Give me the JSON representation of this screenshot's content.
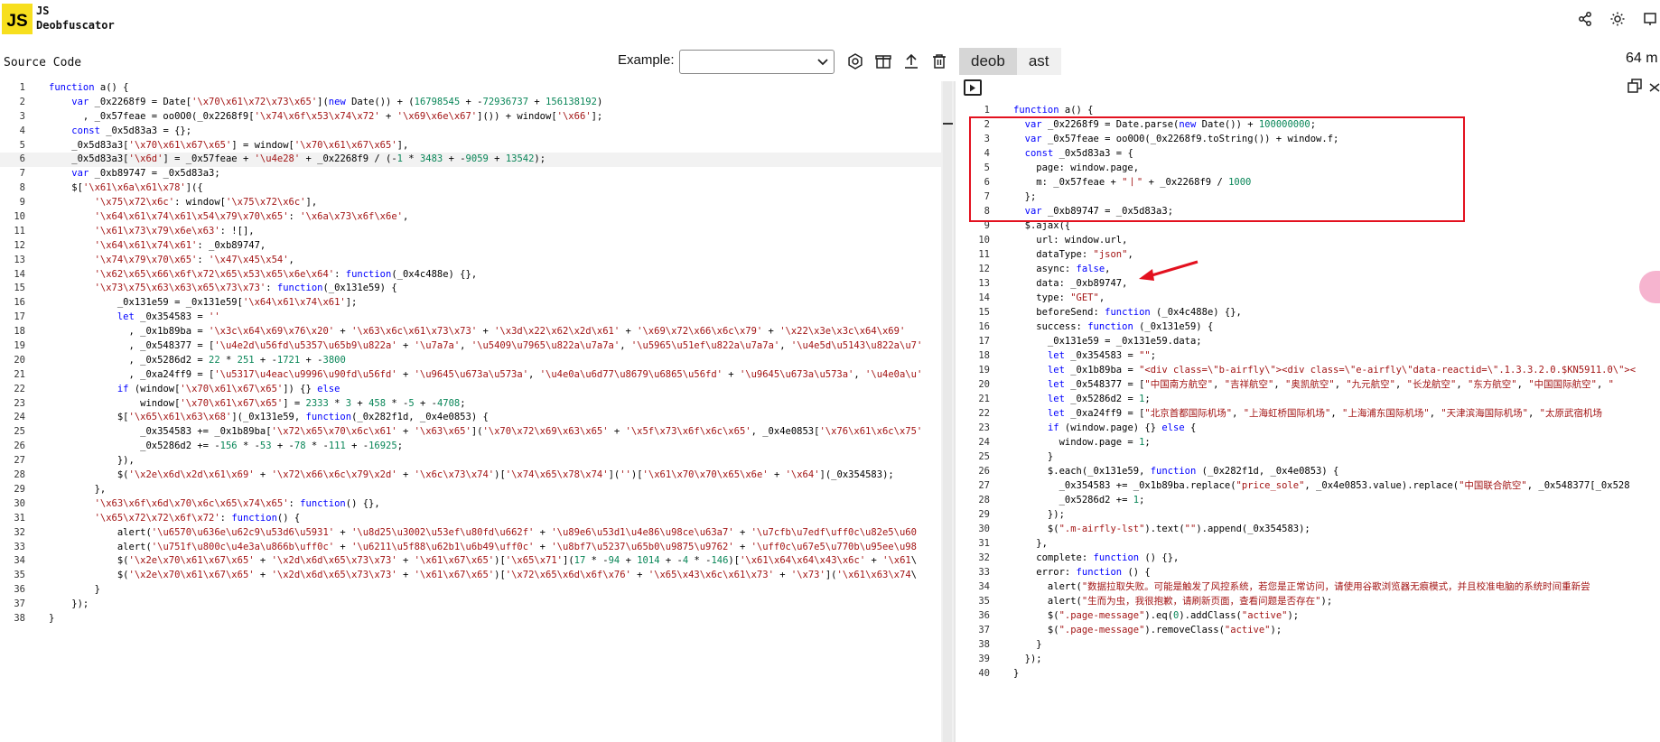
{
  "header": {
    "logo_text": "JS",
    "brand_line1": "JS",
    "brand_line2": "Deobfuscator",
    "icons": [
      "share-icon",
      "theme-sun-icon",
      "window-icon"
    ]
  },
  "toolbar": {
    "source_title": "Source Code",
    "example_label": "Example:",
    "example_selected": "",
    "icons": [
      "settings-icon",
      "package-icon",
      "upload-icon",
      "trash-icon"
    ]
  },
  "tabs": [
    {
      "label": "deob",
      "active": true
    },
    {
      "label": "ast",
      "active": false
    }
  ],
  "output_size": "64 m",
  "source_lines": [
    "function a() {",
    "    var _0x2268f9 = Date['\\x70\\x61\\x72\\x73\\x65'](new Date()) + (16798545 + -72936737 + 156138192)",
    "      , _0x57feae = oo0O0(_0x2268f9['\\x74\\x6f\\x53\\x74\\x72' + '\\x69\\x6e\\x67']()) + window['\\x66'];",
    "    const _0x5d83a3 = {};",
    "    _0x5d83a3['\\x70\\x61\\x67\\x65'] = window['\\x70\\x61\\x67\\x65'],",
    "    _0x5d83a3['\\x6d'] = _0x57feae + '\\u4e28' + _0x2268f9 / (-1 * 3483 + -9059 + 13542);",
    "    var _0xb89747 = _0x5d83a3;",
    "    $['\\x61\\x6a\\x61\\x78']({",
    "        '\\x75\\x72\\x6c': window['\\x75\\x72\\x6c'],",
    "        '\\x64\\x61\\x74\\x61\\x54\\x79\\x70\\x65': '\\x6a\\x73\\x6f\\x6e',",
    "        '\\x61\\x73\\x79\\x6e\\x63': ![],",
    "        '\\x64\\x61\\x74\\x61': _0xb89747,",
    "        '\\x74\\x79\\x70\\x65': '\\x47\\x45\\x54',",
    "        '\\x62\\x65\\x66\\x6f\\x72\\x65\\x53\\x65\\x6e\\x64': function(_0x4c488e) {},",
    "        '\\x73\\x75\\x63\\x63\\x65\\x73\\x73': function(_0x131e59) {",
    "            _0x131e59 = _0x131e59['\\x64\\x61\\x74\\x61'];",
    "            let _0x354583 = ''",
    "              , _0x1b89ba = '\\x3c\\x64\\x69\\x76\\x20' + '\\x63\\x6c\\x61\\x73\\x73' + '\\x3d\\x22\\x62\\x2d\\x61' + '\\x69\\x72\\x66\\x6c\\x79' + '\\x22\\x3e\\x3c\\x64\\x69'",
    "              , _0x548377 = ['\\u4e2d\\u56fd\\u5357\\u65b9\\u822a' + '\\u7a7a', '\\u5409\\u7965\\u822a\\u7a7a', '\\u5965\\u51ef\\u822a\\u7a7a', '\\u4e5d\\u5143\\u822a\\u7'",
    "              , _0x5286d2 = 22 * 251 + -1721 + -3800",
    "              , _0xa24ff9 = ['\\u5317\\u4eac\\u9996\\u90fd\\u56fd' + '\\u9645\\u673a\\u573a', '\\u4e0a\\u6d77\\u8679\\u6865\\u56fd' + '\\u9645\\u673a\\u573a', '\\u4e0a\\u'",
    "            if (window['\\x70\\x61\\x67\\x65']) {} else",
    "                window['\\x70\\x61\\x67\\x65'] = 2333 * 3 + 458 * -5 + -4708;",
    "            $['\\x65\\x61\\x63\\x68'](_0x131e59, function(_0x282f1d, _0x4e0853) {",
    "                _0x354583 += _0x1b89ba['\\x72\\x65\\x70\\x6c\\x61' + '\\x63\\x65']('\\x70\\x72\\x69\\x63\\x65' + '\\x5f\\x73\\x6f\\x6c\\x65', _0x4e0853['\\x76\\x61\\x6c\\x75'",
    "                _0x5286d2 += -156 * -53 + -78 * -111 + -16925;",
    "            }),",
    "            $('\\x2e\\x6d\\x2d\\x61\\x69' + '\\x72\\x66\\x6c\\x79\\x2d' + '\\x6c\\x73\\x74')['\\x74\\x65\\x78\\x74']('')['\\x61\\x70\\x70\\x65\\x6e' + '\\x64'](_0x354583);",
    "        },",
    "        '\\x63\\x6f\\x6d\\x70\\x6c\\x65\\x74\\x65': function() {},",
    "        '\\x65\\x72\\x72\\x6f\\x72': function() {",
    "            alert('\\u6570\\u636e\\u62c9\\u53d6\\u5931' + '\\u8d25\\u3002\\u53ef\\u80fd\\u662f' + '\\u89e6\\u53d1\\u4e86\\u98ce\\u63a7' + '\\u7cfb\\u7edf\\uff0c\\u82e5\\u60",
    "            alert('\\u751f\\u800c\\u4e3a\\u866b\\uff0c' + '\\u6211\\u5f88\\u62b1\\u6b49\\uff0c' + '\\u8bf7\\u5237\\u65b0\\u9875\\u9762' + '\\uff0c\\u67e5\\u770b\\u95ee\\u98",
    "            $('\\x2e\\x70\\x61\\x67\\x65' + '\\x2d\\x6d\\x65\\x73\\x73' + '\\x61\\x67\\x65')['\\x65\\x71'](17 * -94 + 1014 + -4 * -146)['\\x61\\x64\\x64\\x43\\x6c' + '\\x61\\",
    "            $('\\x2e\\x70\\x61\\x67\\x65' + '\\x2d\\x6d\\x65\\x73\\x73' + '\\x61\\x67\\x65')['\\x72\\x65\\x6d\\x6f\\x76' + '\\x65\\x43\\x6c\\x61\\x73' + '\\x73']('\\x61\\x63\\x74\\",
    "        }",
    "    });",
    "}"
  ],
  "deob_lines": [
    "function a() {",
    "  var _0x2268f9 = Date.parse(new Date()) + 100000000;",
    "  var _0x57feae = oo0O0(_0x2268f9.toString()) + window.f;",
    "  const _0x5d83a3 = {",
    "    page: window.page,",
    "    m: _0x57feae + \"丨\" + _0x2268f9 / 1000",
    "  };",
    "  var _0xb89747 = _0x5d83a3;",
    "  $.ajax({",
    "    url: window.url,",
    "    dataType: \"json\",",
    "    async: false,",
    "    data: _0xb89747,",
    "    type: \"GET\",",
    "    beforeSend: function (_0x4c488e) {},",
    "    success: function (_0x131e59) {",
    "      _0x131e59 = _0x131e59.data;",
    "      let _0x354583 = \"\";",
    "      let _0x1b89ba = \"<div class=\\\"b-airfly\\\"><div class=\\\"e-airfly\\\"data-reactid=\\\".1.3.3.2.0.$KN5911.0\\\"><",
    "      let _0x548377 = [\"中国南方航空\", \"吉祥航空\", \"奥凯航空\", \"九元航空\", \"长龙航空\", \"东方航空\", \"中国国际航空\", \"",
    "      let _0x5286d2 = 1;",
    "      let _0xa24ff9 = [\"北京首都国际机场\", \"上海虹桥国际机场\", \"上海浦东国际机场\", \"天津滨海国际机场\", \"太原武宿机场",
    "      if (window.page) {} else {",
    "        window.page = 1;",
    "      }",
    "      $.each(_0x131e59, function (_0x282f1d, _0x4e0853) {",
    "        _0x354583 += _0x1b89ba.replace(\"price_sole\", _0x4e0853.value).replace(\"中国联合航空\", _0x548377[_0x528",
    "        _0x5286d2 += 1;",
    "      });",
    "      $(\".m-airfly-lst\").text(\"\").append(_0x354583);",
    "    },",
    "    complete: function () {},",
    "    error: function () {",
    "      alert(\"数据拉取失败。可能是触发了风控系统，若您是正常访问，请使用谷歌浏览器无痕模式，并且校准电脑的系统时间重新尝",
    "      alert(\"生而为虫，我很抱歉，请刷新页面，查看问题是否存在\");",
    "      $(\".page-message\").eq(0).addClass(\"active\");",
    "      $(\".page-message\").removeClass(\"active\");",
    "    }",
    "  });",
    "}"
  ],
  "colors": {
    "logo_bg": "#f7df1e",
    "annotation_red": "#e3111f",
    "keyword": "#0000ff",
    "string": "#a31515",
    "number": "#098658"
  }
}
